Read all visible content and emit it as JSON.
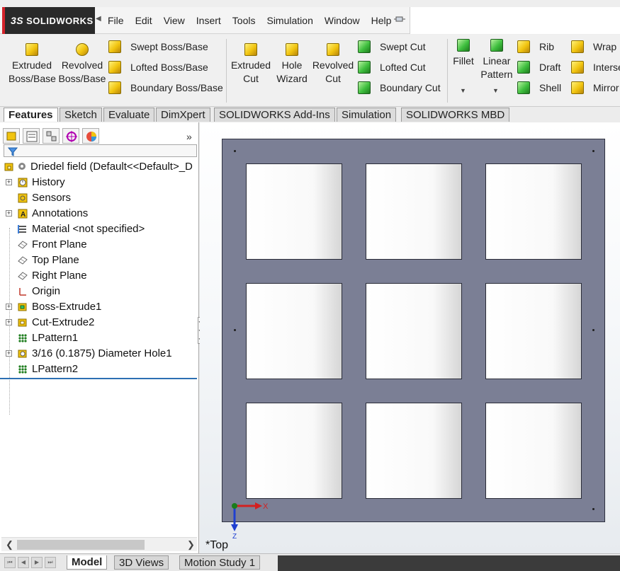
{
  "app": {
    "logo_text": "SOLIDWORKS",
    "logo_mark": "3S"
  },
  "menu": {
    "items": [
      "File",
      "Edit",
      "View",
      "Insert",
      "Tools",
      "Simulation",
      "Window",
      "Help"
    ]
  },
  "command_manager": {
    "extruded_boss": [
      "Extruded",
      "Boss/Base"
    ],
    "revolved_boss": [
      "Revolved",
      "Boss/Base"
    ],
    "swept_boss": "Swept Boss/Base",
    "lofted_boss": "Lofted Boss/Base",
    "boundary_boss": "Boundary Boss/Base",
    "extruded_cut": [
      "Extruded",
      "Cut"
    ],
    "hole_wizard": [
      "Hole",
      "Wizard"
    ],
    "revolved_cut": [
      "Revolved",
      "Cut"
    ],
    "swept_cut": "Swept Cut",
    "lofted_cut": "Lofted Cut",
    "boundary_cut": "Boundary Cut",
    "fillet": "Fillet",
    "linear_pattern": [
      "Linear",
      "Pattern"
    ],
    "rib": "Rib",
    "draft": "Draft",
    "shell": "Shell",
    "wrap": "Wrap",
    "intersect": "Interse",
    "mirror": "Mirror"
  },
  "tabs": [
    "Features",
    "Sketch",
    "Evaluate",
    "DimXpert",
    "SOLIDWORKS Add-Ins",
    "Simulation",
    "SOLIDWORKS MBD"
  ],
  "active_tab": "Features",
  "feature_tree": {
    "root": "Driedel field  (Default<<Default>_D",
    "items": [
      {
        "label": "History",
        "expandable": true,
        "icon": "history-icon"
      },
      {
        "label": "Sensors",
        "expandable": false,
        "icon": "sensor-icon"
      },
      {
        "label": "Annotations",
        "expandable": true,
        "icon": "annotation-icon"
      },
      {
        "label": "Material <not specified>",
        "expandable": false,
        "icon": "material-icon"
      },
      {
        "label": "Front Plane",
        "expandable": false,
        "icon": "plane-icon"
      },
      {
        "label": "Top Plane",
        "expandable": false,
        "icon": "plane-icon"
      },
      {
        "label": "Right Plane",
        "expandable": false,
        "icon": "plane-icon"
      },
      {
        "label": "Origin",
        "expandable": false,
        "icon": "origin-icon"
      },
      {
        "label": "Boss-Extrude1",
        "expandable": true,
        "icon": "boss-extrude-icon"
      },
      {
        "label": "Cut-Extrude2",
        "expandable": true,
        "icon": "cut-extrude-icon"
      },
      {
        "label": "LPattern1",
        "expandable": false,
        "icon": "linear-pattern-icon"
      },
      {
        "label": "3/16 (0.1875) Diameter Hole1",
        "expandable": true,
        "icon": "hole-icon"
      },
      {
        "label": "LPattern2",
        "expandable": false,
        "icon": "linear-pattern-icon"
      }
    ]
  },
  "viewport": {
    "view_name": "*Top",
    "triad_x": "X",
    "triad_z": "Z"
  },
  "bottom_tabs": [
    "Model",
    "3D Views",
    "Motion Study 1"
  ],
  "active_bottom_tab": "Model",
  "colors": {
    "plate": "#7b7f95",
    "accent_red": "#d3222a",
    "tree_end_line": "#2d6fb3"
  }
}
